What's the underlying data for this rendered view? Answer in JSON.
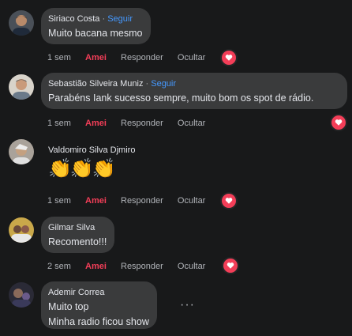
{
  "comments": [
    {
      "author": "Siriaco Costa",
      "follow": "Seguir",
      "separator": " · ",
      "text": "Muito bacana mesmo",
      "time": "1 sem",
      "liked_label": "Amei",
      "reply_label": "Responder",
      "hide_label": "Ocultar",
      "reaction_icon": "heart-icon",
      "avatar_color": "#6b4f3a"
    },
    {
      "author": "Sebastião Silveira Muniz",
      "follow": "Seguir",
      "separator": " · ",
      "text": "Parabéns Iank sucesso sempre, muito bom os spot de rádio.",
      "time": "1 sem",
      "liked_label": "Amei",
      "reply_label": "Responder",
      "hide_label": "Ocultar",
      "reaction_icon": "heart-icon",
      "avatar_color": "#c9c3b8"
    },
    {
      "author": "Valdomiro Silva Djmiro",
      "text": "👏👏👏",
      "time": "1 sem",
      "liked_label": "Amei",
      "reply_label": "Responder",
      "hide_label": "Ocultar",
      "reaction_icon": "heart-icon",
      "avatar_color": "#9a8f86"
    },
    {
      "author": "Gilmar Silva",
      "text": "Recomento!!!",
      "time": "2 sem",
      "liked_label": "Amei",
      "reply_label": "Responder",
      "hide_label": "Ocultar",
      "reaction_icon": "heart-icon",
      "avatar_color": "#7a6a3a"
    },
    {
      "author": "Ademir Correa",
      "text_line1": "Muito top",
      "text_line2": "Minha radio ficou show",
      "more_label": "···",
      "avatar_color": "#3a3a4a"
    }
  ],
  "colors": {
    "background": "#18191a",
    "bubble": "#3a3b3c",
    "link": "#4599ff",
    "love": "#f33e58",
    "muted": "#b0b3b8"
  }
}
